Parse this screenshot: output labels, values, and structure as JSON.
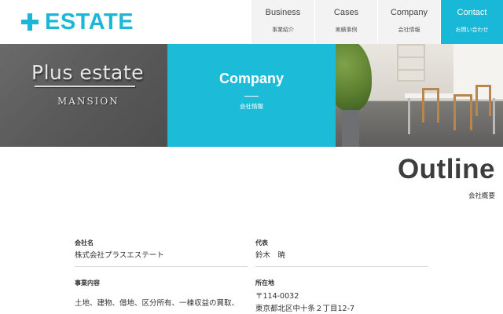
{
  "header": {
    "logo_text": "ESTATE",
    "brand_color": "#1ab8d8",
    "nav": [
      {
        "en": "Business",
        "ja": "事業紹介"
      },
      {
        "en": "Cases",
        "ja": "実績事例"
      },
      {
        "en": "Company",
        "ja": "会社情報"
      },
      {
        "en": "Contact",
        "ja": "お問い合わせ",
        "active": true
      }
    ]
  },
  "hero": {
    "sign_main": "Plus estate",
    "sign_sub": "MANSION",
    "title": "Company",
    "subtitle": "会社情報"
  },
  "outline": {
    "title": "Outline",
    "subtitle": "会社概要"
  },
  "info": {
    "company_name": {
      "label": "会社名",
      "value": "株式会社プラスエステート"
    },
    "representative": {
      "label": "代表",
      "value": "鈴木　暁"
    },
    "business": {
      "label": "事業内容",
      "value": "土地、建物、借地、区分所有、一棟収益の買取、"
    },
    "address": {
      "label": "所在地",
      "postal": "〒114-0032",
      "value": "東京都北区中十条２丁目12-7"
    }
  }
}
